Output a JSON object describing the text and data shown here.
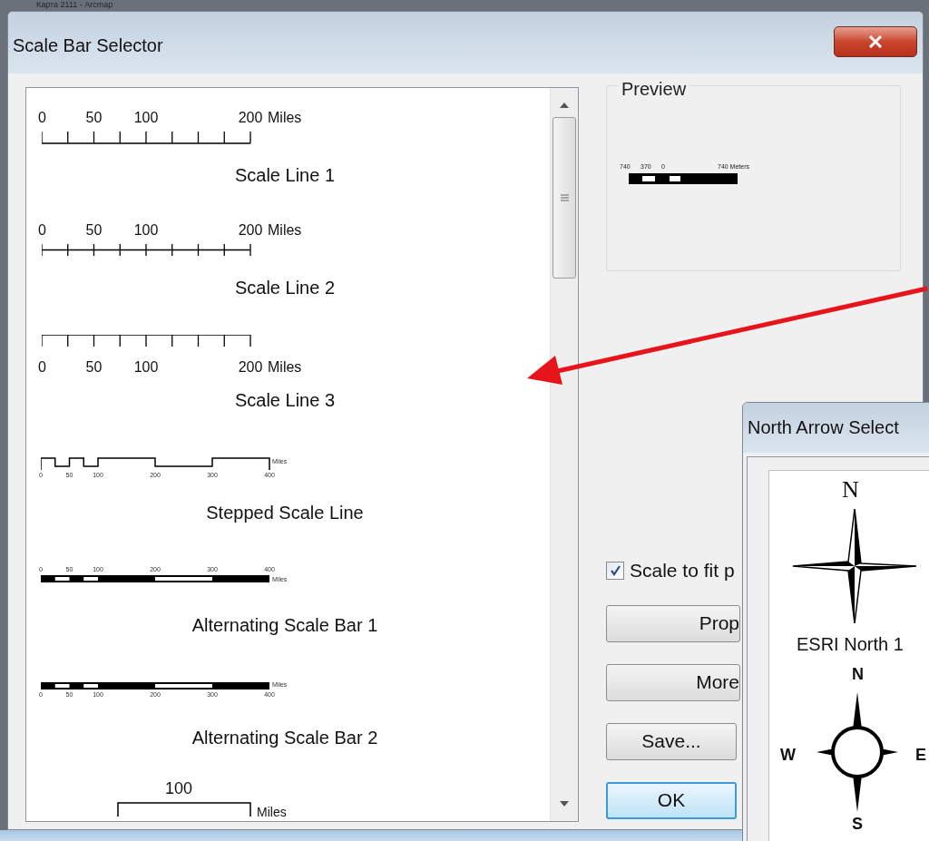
{
  "parent_window": {
    "title": "Карта 2111 - Arcmap"
  },
  "dialog": {
    "title": "Scale Bar Selector",
    "styles": [
      {
        "kind": "ticks_up",
        "ticks": [
          "0",
          "50",
          "100",
          "200"
        ],
        "unit": "Miles",
        "name": "Scale Line 1"
      },
      {
        "kind": "ticks_through",
        "ticks": [
          "0",
          "50",
          "100",
          "200"
        ],
        "unit": "Miles",
        "name": "Scale Line 2"
      },
      {
        "kind": "ticks_down",
        "ticks": [
          "0",
          "50",
          "100",
          "200"
        ],
        "unit": "Miles",
        "name": "Scale Line 3"
      },
      {
        "kind": "stepped",
        "ticks": [
          "0",
          "50",
          "100",
          "200",
          "300",
          "400"
        ],
        "unit": "Miles",
        "name": "Stepped Scale Line"
      },
      {
        "kind": "bar_labels_above",
        "ticks": [
          "0",
          "50",
          "100",
          "200",
          "300",
          "400"
        ],
        "unit": "Miles",
        "name": "Alternating Scale Bar 1"
      },
      {
        "kind": "bar_labels_below",
        "ticks": [
          "0",
          "50",
          "100",
          "200",
          "300",
          "400"
        ],
        "unit": "Miles",
        "name": "Alternating Scale Bar 2"
      },
      {
        "kind": "box",
        "ticks": [
          "100"
        ],
        "unit": "Miles"
      }
    ],
    "preview": {
      "legend": "Preview",
      "ticks": [
        "740",
        "370",
        "0"
      ],
      "unit": "740 Meters"
    },
    "scale_to_fit": {
      "label": "Scale to fit p",
      "checked": true
    },
    "buttons": [
      {
        "label": "Prop",
        "kind": "cut"
      },
      {
        "label": "More",
        "kind": "cut"
      },
      {
        "label": "Save...",
        "kind": "normal"
      },
      {
        "label": "OK",
        "kind": "default"
      }
    ]
  },
  "north_arrow_dialog": {
    "title": "North Arrow Select",
    "items": [
      {
        "kind": "star",
        "letters": [
          "N"
        ],
        "name": "ESRI North 1"
      },
      {
        "kind": "circle",
        "letters": [
          "N",
          "W",
          "E",
          "S"
        ]
      }
    ]
  }
}
